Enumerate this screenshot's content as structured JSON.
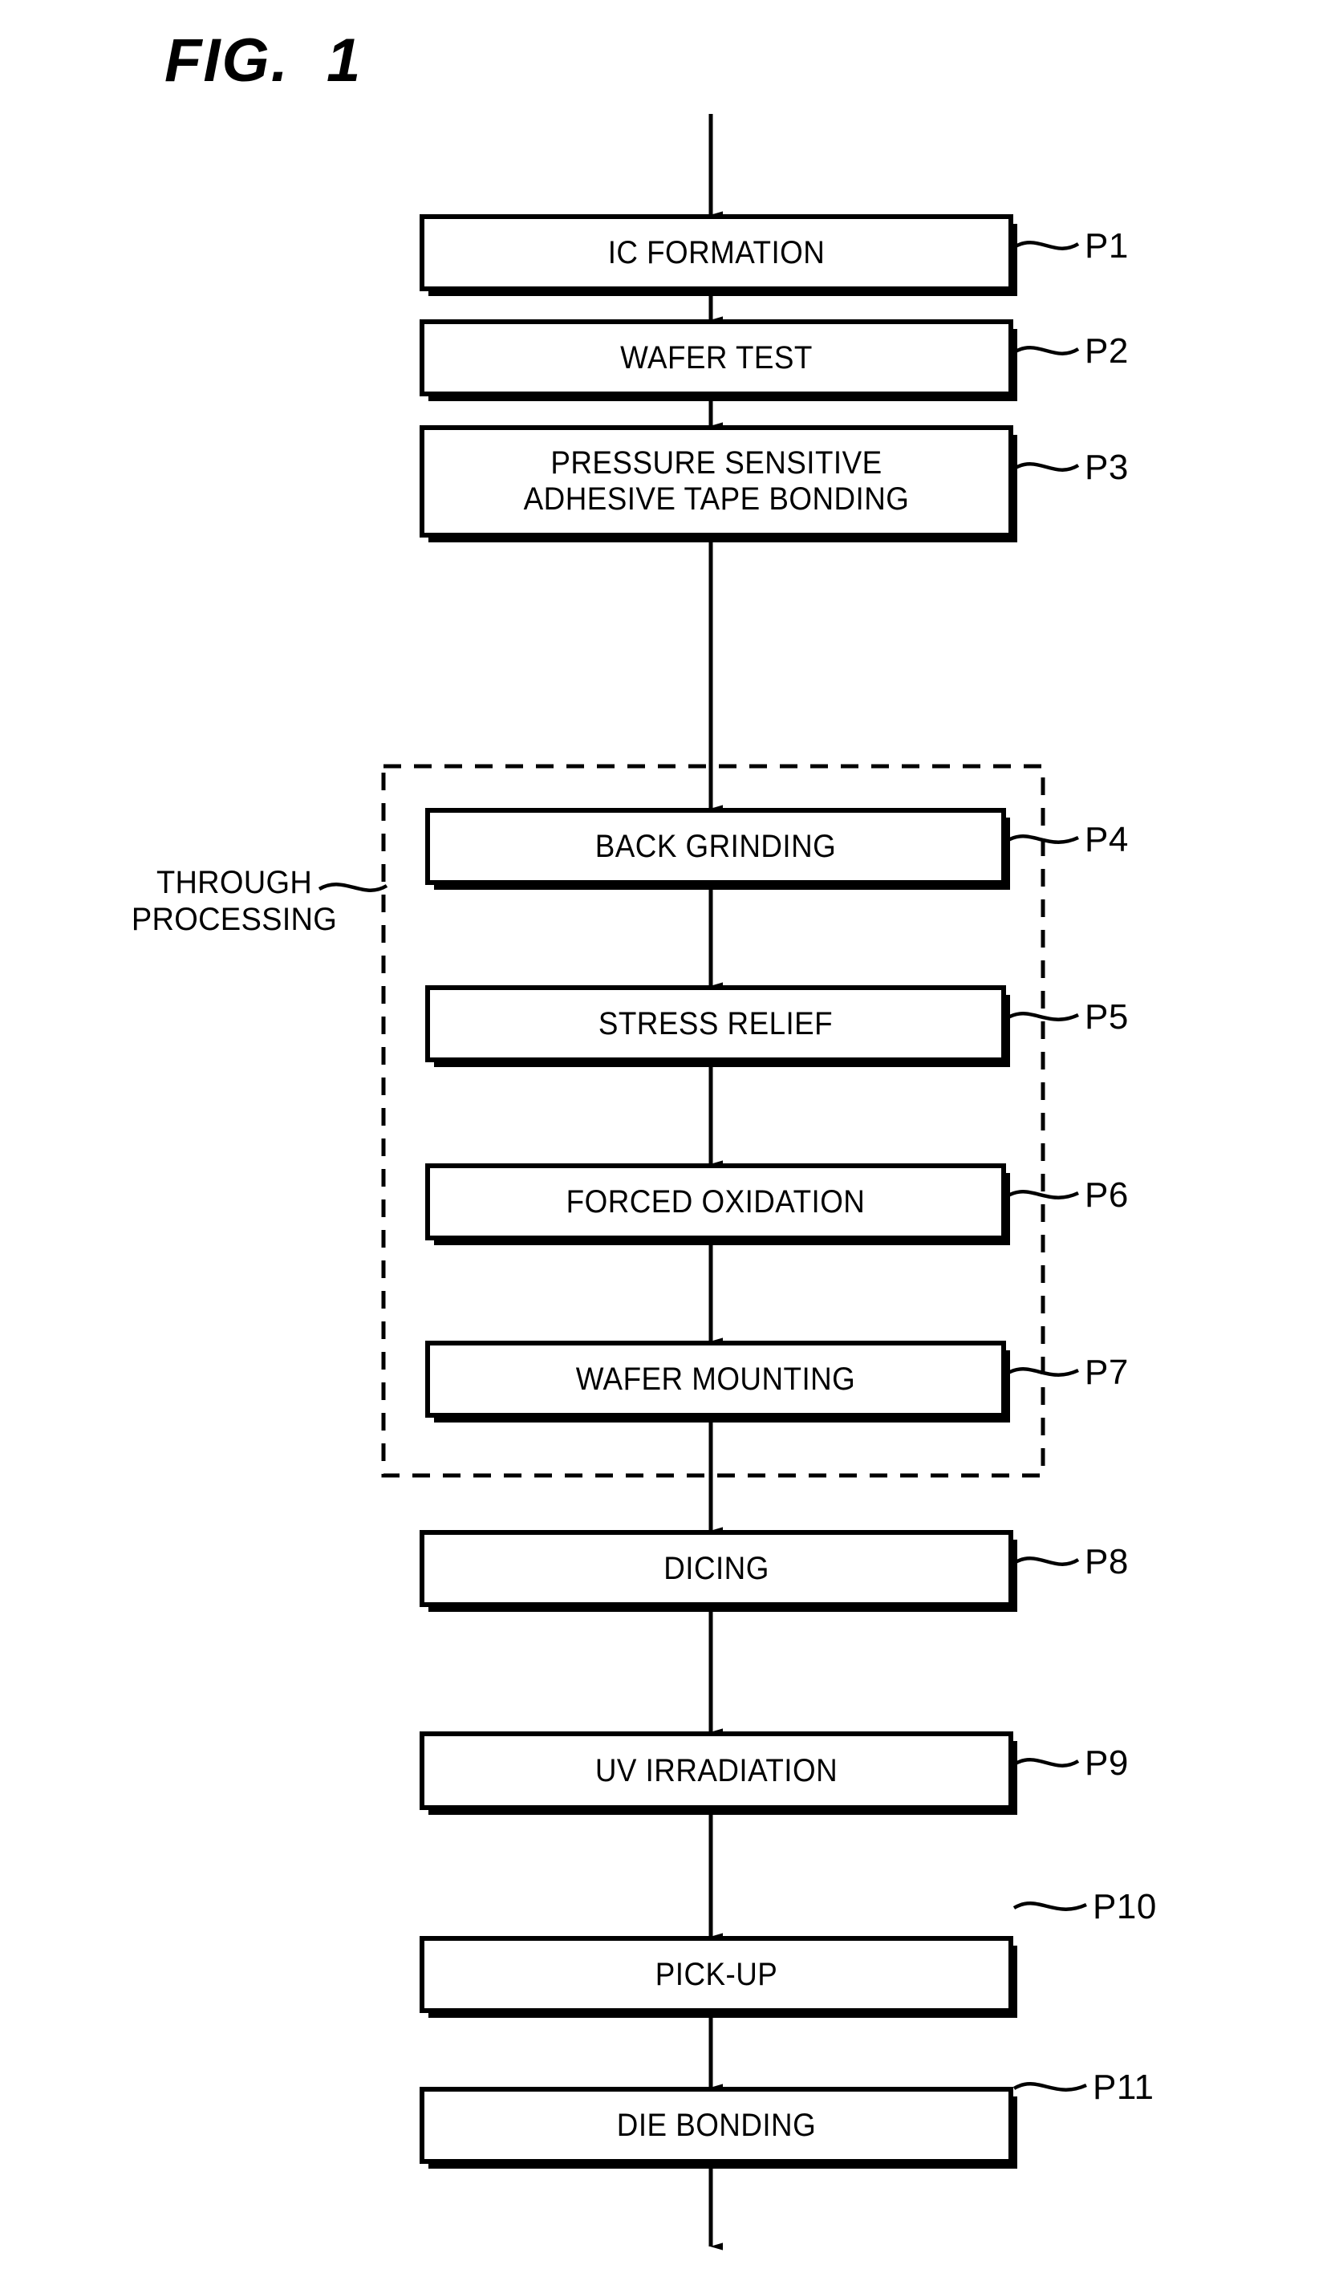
{
  "figure": {
    "title": "FIG.  1",
    "type": "process-flow-diagram",
    "line_color": "#000000",
    "background_color": "#ffffff"
  },
  "callout": {
    "label": "THROUGH\nPROCESSING",
    "group_name": "through-processing-group"
  },
  "steps": [
    {
      "id": "P1",
      "label": "IC FORMATION",
      "ref": "P1",
      "lines": 1,
      "in_group": false
    },
    {
      "id": "P2",
      "label": "WAFER TEST",
      "ref": "P2",
      "lines": 1,
      "in_group": false
    },
    {
      "id": "P3",
      "label": "PRESSURE SENSITIVE\nADHESIVE TAPE BONDING",
      "ref": "P3",
      "lines": 2,
      "in_group": false
    },
    {
      "id": "P4",
      "label": "BACK GRINDING",
      "ref": "P4",
      "lines": 1,
      "in_group": true
    },
    {
      "id": "P5",
      "label": "STRESS RELIEF",
      "ref": "P5",
      "lines": 1,
      "in_group": true
    },
    {
      "id": "P6",
      "label": "FORCED OXIDATION",
      "ref": "P6",
      "lines": 1,
      "in_group": true
    },
    {
      "id": "P7",
      "label": "WAFER MOUNTING",
      "ref": "P7",
      "lines": 1,
      "in_group": true
    },
    {
      "id": "P8",
      "label": "DICING",
      "ref": "P8",
      "lines": 1,
      "in_group": false
    },
    {
      "id": "P9",
      "label": "UV IRRADIATION",
      "ref": "P9",
      "lines": 1,
      "in_group": false
    },
    {
      "id": "P10",
      "label": "PICK-UP",
      "ref": "P10",
      "lines": 1,
      "in_group": false
    },
    {
      "id": "P11",
      "label": "DIE BONDING",
      "ref": "P11",
      "lines": 1,
      "in_group": false
    }
  ],
  "flow": {
    "entry_arrow": true,
    "exit_arrow": true,
    "connectors": 10,
    "direction": "top-to-bottom"
  }
}
